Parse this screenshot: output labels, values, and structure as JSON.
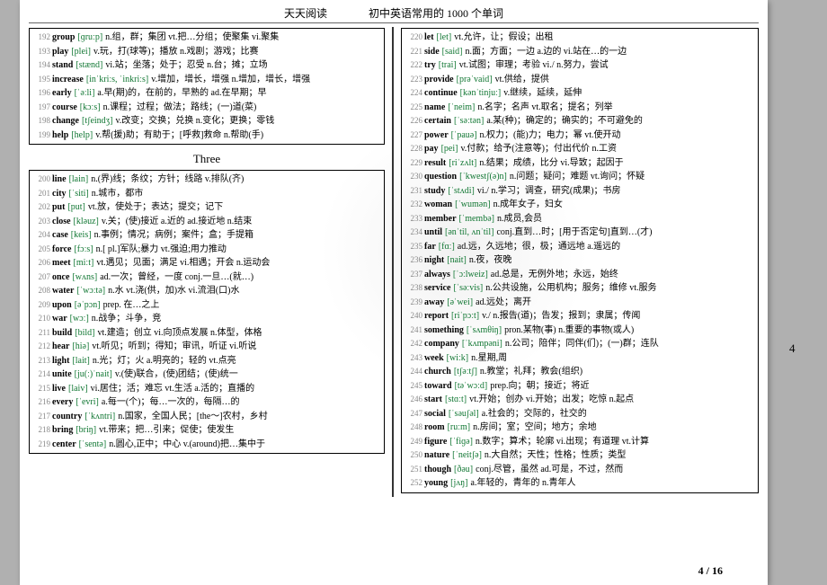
{
  "header": {
    "brand": "天天阅读",
    "title": "初中英语常用的 1000 个单词"
  },
  "section": {
    "three": "Three"
  },
  "footer": {
    "pagenum": "4 / 16",
    "margin": "4"
  },
  "left_top": [
    {
      "n": 192,
      "w": "group",
      "p": "[ɡruːp]",
      "d": "n.组，群；集团 vt.把…分组；使聚集 vi.聚集"
    },
    {
      "n": 193,
      "w": "play",
      "p": "[plei]",
      "d": "v.玩，打(球等)；播放 n.戏剧；游戏；比赛"
    },
    {
      "n": 194,
      "w": "stand",
      "p": "[stænd]",
      "d": "vi.站；坐落；处于；忍受 n.台；摊；立场"
    },
    {
      "n": 195,
      "w": "increase",
      "p": "[inˈkriːs, ˈinkriːs]",
      "d": "v.增加，增长，增强 n.增加，增长，增强"
    },
    {
      "n": 196,
      "w": "early",
      "p": "[ˈəːli]",
      "d": "a.早(期)的，在前的，早熟的 ad.在早期；早"
    },
    {
      "n": 197,
      "w": "course",
      "p": "[kɔːs]",
      "d": "n.课程；过程；做法；路线；(一)道(菜)"
    },
    {
      "n": 198,
      "w": "change",
      "p": "[tʃeindʒ]",
      "d": "v.改变；交换；兑换 n.变化；更换；零钱"
    },
    {
      "n": 199,
      "w": "help",
      "p": "[help]",
      "d": "v.帮(援)助；有助于；[呼救]救命 n.帮助(手)"
    }
  ],
  "left_bottom": [
    {
      "n": 200,
      "w": "line",
      "p": "[lain]",
      "d": "n.(界)线；条纹；方针；线路 v.排队(齐)"
    },
    {
      "n": 201,
      "w": "city",
      "p": "[ˈsiti]",
      "d": "n.城市，都市"
    },
    {
      "n": 202,
      "w": "put",
      "p": "[put]",
      "d": "vt.放，使处于；表达；提交；记下"
    },
    {
      "n": 203,
      "w": "close",
      "p": "[kləuz]",
      "d": "v.关；(使)接近 a.近的 ad.接近地 n.结束"
    },
    {
      "n": 204,
      "w": "case",
      "p": "[keis]",
      "d": "n.事例；情况；病例；案件；盒；手提箱"
    },
    {
      "n": 205,
      "w": "force",
      "p": "[fɔːs]",
      "d": "n.[ pl.]军队;暴力 vt.强迫;用力推动"
    },
    {
      "n": 206,
      "w": "meet",
      "p": "[miːt]",
      "d": "vt.遇见；见面；满足 vi.相遇；开会 n.运动会"
    },
    {
      "n": 207,
      "w": "once",
      "p": "[wʌns]",
      "d": "ad.一次；曾经，一度 conj.一旦…(就…)"
    },
    {
      "n": 208,
      "w": "water",
      "p": "[ˈwɔːtə]",
      "d": "n.水 vt.浇(供，加)水 vi.流泪(口)水"
    },
    {
      "n": 209,
      "w": "upon",
      "p": "[əˈpɔn]",
      "d": "prep. 在…之上"
    },
    {
      "n": 210,
      "w": "war",
      "p": "[wɔː]",
      "d": "n.战争；斗争，竞"
    },
    {
      "n": 211,
      "w": "build",
      "p": "[bild]",
      "d": "vt.建造；创立 vi.向顶点发展 n.体型，体格"
    },
    {
      "n": 212,
      "w": "hear",
      "p": "[hiə]",
      "d": "vt.听见；听到；得知；审讯，听证 vi.听说"
    },
    {
      "n": 213,
      "w": "light",
      "p": "[lait]",
      "d": "n.光；灯；火 a.明亮的；轻的 vt.点亮"
    },
    {
      "n": 214,
      "w": "unite",
      "p": "[ju(ː)ˈnait]",
      "d": "v.(使)联合，(使)团结；(使)统一"
    },
    {
      "n": 215,
      "w": "live",
      "p": "[laiv]",
      "d": "vi.居住；活；难忘 vt.生活 a.活的；直播的"
    },
    {
      "n": 216,
      "w": "every",
      "p": "[ˈevri]",
      "d": "a.每一(个)；每…一次的，每隔…的"
    },
    {
      "n": 217,
      "w": "country",
      "p": "[ˈkʌntri]",
      "d": "n.国家，全国人民；[the～]农村，乡村"
    },
    {
      "n": 218,
      "w": "bring",
      "p": "[briŋ]",
      "d": "vt.带来；把…引来；促使；使发生"
    },
    {
      "n": 219,
      "w": "center",
      "p": "[ˈsentə]",
      "d": "n.圆心,正中；中心 v.(around)把…集中于"
    }
  ],
  "right": [
    {
      "n": 220,
      "w": "let",
      "p": "[let]",
      "d": "vt.允许，让；假设；出租"
    },
    {
      "n": 221,
      "w": "side",
      "p": "[said]",
      "d": "n.面；方面；一边 a.边的 vi.站在…的一边"
    },
    {
      "n": 222,
      "w": "try",
      "p": "[trai]",
      "d": "vt.试图；审理；考验 vi./ n.努力，尝试"
    },
    {
      "n": 223,
      "w": "provide",
      "p": "[prəˈvaid]",
      "d": "vt.供给，提供"
    },
    {
      "n": 224,
      "w": "continue",
      "p": "[kənˈtinjuː]",
      "d": "v.继续，延续，延伸"
    },
    {
      "n": 225,
      "w": "name",
      "p": "[ˈneim]",
      "d": "n.名字；名声 vt.取名；提名；列举"
    },
    {
      "n": 226,
      "w": "certain",
      "p": "[ˈsəːtən]",
      "d": "a.某(种)；确定的；确实的；不可避免的"
    },
    {
      "n": 227,
      "w": "power",
      "p": "[ˈpauə]",
      "d": "n.权力；(能)力；电力；幂 vt.使开动"
    },
    {
      "n": 228,
      "w": "pay",
      "p": "[pei]",
      "d": "v.付款；给予(注意等)；付出代价 n.工资"
    },
    {
      "n": 229,
      "w": "result",
      "p": "[riˈzʌlt]",
      "d": "n.结果；成绩，比分 vi.导致；起因于"
    },
    {
      "n": 230,
      "w": "question",
      "p": "[ˈkwestʃ(ə)n]",
      "d": "n.问题；疑问；难题 vt.询问；怀疑"
    },
    {
      "n": 231,
      "w": "study",
      "p": "[ˈstʌdi]",
      "d": "vi./ n.学习；调查，研究(成果)；书房"
    },
    {
      "n": 232,
      "w": "woman",
      "p": "[ˈwumən]",
      "d": "n.成年女子，妇女"
    },
    {
      "n": 233,
      "w": "member",
      "p": "[ˈmembə]",
      "d": "n.成员,会员"
    },
    {
      "n": 234,
      "w": "until",
      "p": "[ənˈtil, ʌnˈtil]",
      "d": "conj.直到…时；[用于否定句]直到…(才)"
    },
    {
      "n": 235,
      "w": "far",
      "p": "[fɑː]",
      "d": "ad.远，久远地；很，极；通远地 a.遥远的"
    },
    {
      "n": 236,
      "w": "night",
      "p": "[nait]",
      "d": "n.夜，夜晚"
    },
    {
      "n": 237,
      "w": "always",
      "p": "[ˈɔːlweiz]",
      "d": "ad.总是，无例外地；永远，始终"
    },
    {
      "n": 238,
      "w": "service",
      "p": "[ˈsəːvis]",
      "d": "n.公共设施，公用机构；服务；维修 vt.服务"
    },
    {
      "n": 239,
      "w": "away",
      "p": "[əˈwei]",
      "d": "ad.远处；离开"
    },
    {
      "n": 240,
      "w": "report",
      "p": "[riˈpɔːt]",
      "d": "v./ n.报告(道)；告发；报到；隶属；传闻"
    },
    {
      "n": 241,
      "w": "something",
      "p": "[ˈsʌmθiŋ]",
      "d": "pron.某物(事) n.重要的事物(或人)"
    },
    {
      "n": 242,
      "w": "company",
      "p": "[ˈkʌmpəni]",
      "d": "n.公司；陪伴；同伴(们)；(一)群；连队"
    },
    {
      "n": 243,
      "w": "week",
      "p": "[wiːk]",
      "d": "n.星期,周"
    },
    {
      "n": 244,
      "w": "church",
      "p": "[tʃəːtʃ]",
      "d": "n.教堂；礼拜；教会(组织)"
    },
    {
      "n": 245,
      "w": "toward",
      "p": "[təˈwɔːd]",
      "d": "prep.向；朝；接近；将近"
    },
    {
      "n": 246,
      "w": "start",
      "p": "[stɑːt]",
      "d": "vt.开始；创办 vi.开始；出发；吃惊 n.起点"
    },
    {
      "n": 247,
      "w": "social",
      "p": "[ˈsəuʃəl]",
      "d": "a.社会的；交际的，社交的"
    },
    {
      "n": 248,
      "w": "room",
      "p": "[ruːm]",
      "d": "n.房间；室；空间；地方；余地"
    },
    {
      "n": 249,
      "w": "figure",
      "p": "[ˈfiɡə]",
      "d": "n.数字；算术；轮廓 vi.出现；有道理 vt.计算"
    },
    {
      "n": 250,
      "w": "nature",
      "p": "[ˈneitʃə]",
      "d": "n.大自然；天性；性格；性质；类型"
    },
    {
      "n": 251,
      "w": "though",
      "p": "[ðəu]",
      "d": "conj.尽管，虽然 ad.可是，不过，然而"
    },
    {
      "n": 252,
      "w": "young",
      "p": "[jʌŋ]",
      "d": "a.年轻的，青年的 n.青年人"
    }
  ]
}
